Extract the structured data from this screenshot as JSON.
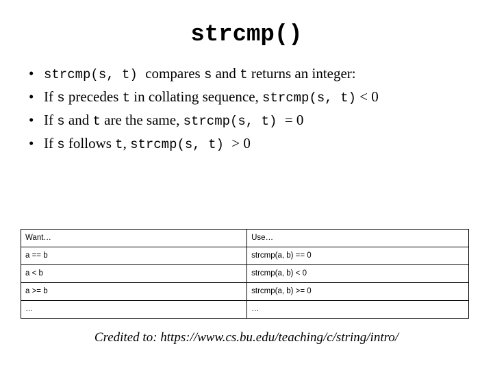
{
  "slide": {
    "title": "strcmp()",
    "bullets": [
      {
        "marker": "•",
        "parts": [
          {
            "text": "strcmp(s, t) ",
            "style": "mono"
          },
          {
            "text": "compares ",
            "style": "serif"
          },
          {
            "text": "s",
            "style": "mono"
          },
          {
            "text": " and ",
            "style": "serif"
          },
          {
            "text": "t",
            "style": "mono"
          },
          {
            "text": " returns an integer:",
            "style": "serif"
          }
        ]
      },
      {
        "marker": "•",
        "parts": [
          {
            "text": "If ",
            "style": "serif"
          },
          {
            "text": "s",
            "style": "mono"
          },
          {
            "text": " precedes ",
            "style": "serif"
          },
          {
            "text": "t",
            "style": "mono"
          },
          {
            "text": " in collating sequence, ",
            "style": "serif"
          },
          {
            "text": "strcmp(s, t)",
            "style": "mono"
          },
          {
            "text": " < 0",
            "style": "serif"
          }
        ]
      },
      {
        "marker": "•",
        "parts": [
          {
            "text": "If ",
            "style": "serif"
          },
          {
            "text": "s",
            "style": "mono"
          },
          {
            "text": " and ",
            "style": "serif"
          },
          {
            "text": "t",
            "style": "mono"
          },
          {
            "text": " are the same, ",
            "style": "serif"
          },
          {
            "text": "strcmp(s, t) ",
            "style": "mono"
          },
          {
            "text": "= 0",
            "style": "serif"
          }
        ]
      },
      {
        "marker": "•",
        "parts": [
          {
            "text": "If ",
            "style": "serif"
          },
          {
            "text": "s",
            "style": "mono"
          },
          {
            "text": " follows ",
            "style": "serif"
          },
          {
            "text": "t",
            "style": "mono"
          },
          {
            "text": ", ",
            "style": "serif"
          },
          {
            "text": "strcmp(s, t) ",
            "style": "mono"
          },
          {
            "text": "> 0",
            "style": "serif"
          }
        ]
      }
    ],
    "table": {
      "rows": [
        {
          "want": "Want…",
          "use": "Use…"
        },
        {
          "want": "a == b",
          "use": "strcmp(a, b) == 0"
        },
        {
          "want": "a < b",
          "use": "strcmp(a, b) < 0"
        },
        {
          "want": "a >= b",
          "use": "strcmp(a, b) >= 0"
        },
        {
          "want": "…",
          "use": "…"
        }
      ]
    },
    "credit": "Credited to: https://www.cs.bu.edu/teaching/c/string/intro/"
  }
}
